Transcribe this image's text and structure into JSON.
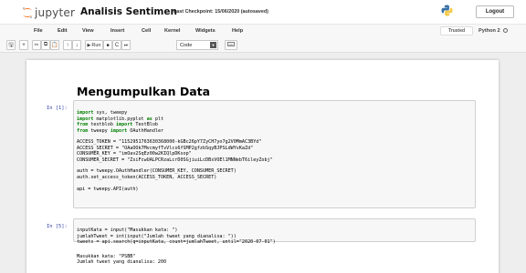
{
  "header": {
    "logo_text": "jupyter",
    "notebook_title": "Analisis Sentimen",
    "checkpoint": "Last Checkpoint: 15/06/2020  (autosaved)",
    "logout_label": "Logout"
  },
  "menubar": {
    "items": [
      "File",
      "Edit",
      "View",
      "Insert",
      "Cell",
      "Kernel",
      "Widgets",
      "Help"
    ],
    "trusted_label": "Trusted",
    "kernel_label": "Python 2"
  },
  "toolbar": {
    "buttons": [
      {
        "icon": "save-icon",
        "glyph": "🖫"
      },
      {
        "icon": "plus-icon",
        "glyph": "+"
      },
      {
        "icon": "cut-icon",
        "glyph": "✂"
      },
      {
        "icon": "copy-icon",
        "glyph": "⧉"
      },
      {
        "icon": "paste-icon",
        "glyph": "📋"
      },
      {
        "icon": "arrow-up-icon",
        "glyph": "↑"
      },
      {
        "icon": "arrow-down-icon",
        "glyph": "↓"
      },
      {
        "icon": "run-icon",
        "glyph": "▶",
        "label": "Run"
      },
      {
        "icon": "stop-icon",
        "glyph": "■"
      },
      {
        "icon": "restart-icon",
        "glyph": "C"
      },
      {
        "icon": "fast-forward-icon",
        "glyph": "⏭"
      }
    ],
    "cell_type": "Code",
    "keyboard_icon": "keyboard-icon"
  },
  "notebook": {
    "heading": "Mengumpulkan Data",
    "cell1": {
      "prompt": "In [1]:",
      "lines": [
        "import sys, tweepy",
        "import matplotlib.pyplot as plt",
        "from textblob import TextBlob",
        "from tweepy import OAuthHandler",
        "",
        "ACCESS_TOKEN = \"1152951763630368000-kGBc26pY7ZyCH7yo7g2V0MmAC3BYd\"",
        "ACCESS_SECRET = \"OAaOOk7MvcmyfTvVlcs6fSMP2gfzbSqyBJPSLdWYvKaZd\"",
        "CONSUMER_KEY = \"imOav2SqEz00w2KIQlpDKsop\"",
        "CONSUMER_SECRET = \"ZsiFcwUALPCRzaLcrD0SGjiuiLcDBsVOEl1MNNebT6ileyZobj\"",
        "",
        "auth = tweepy.OAuthHandler(CONSUMER_KEY, CONSUMER_SECRET)",
        "auth.set_access_token(ACCESS_TOKEN, ACCESS_SECRET)",
        "",
        "api = tweepy.API(auth)"
      ]
    },
    "cell2": {
      "prompt": "In [5]:",
      "lines": [
        "inputKata = input(\"Masukkan kata: \")",
        "jumlahTweet = int(input(\"Jumlah tweet yang dianalisa: \"))",
        "tweets = api.search(q=inputKata, count=jumlahTweet, until=\"2020-07-01\")"
      ],
      "output": [
        "Masukkan kata: \"PSBB\"",
        "Jumlah tweet yang dianalisa: 200"
      ]
    }
  },
  "colors": {
    "prompt": "#303f9f",
    "keyword": "#008000",
    "string": "#ba2121",
    "logo_orange": "#f37726"
  }
}
